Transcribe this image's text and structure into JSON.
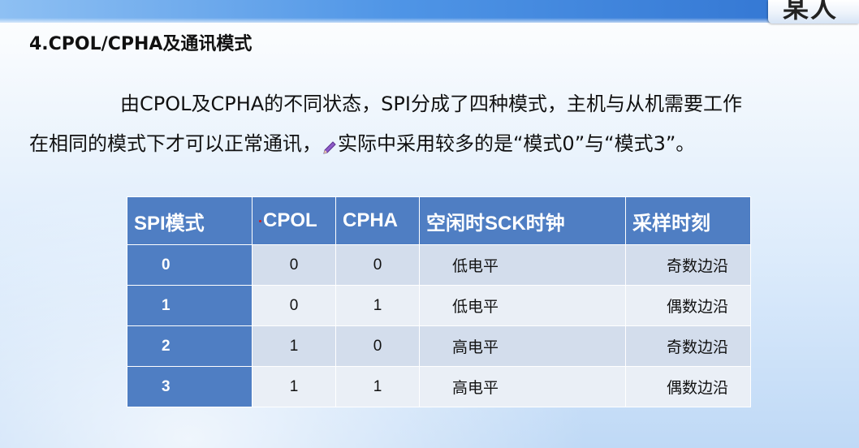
{
  "header": {
    "corner_tab_text": "某人"
  },
  "slide": {
    "title": "4.CPOL/CPHA及通讯模式",
    "paragraph": {
      "line1": "由CPOL及CPHA的不同状态，SPI分成了四种模式，主机与从机需要工作",
      "line2_before": "在相同的模式下才可以正常通讯，",
      "line2_after": "实际中采用较多的是“模式0”与“模式3”。",
      "inline_icon": "pen-icon"
    }
  },
  "table": {
    "headers": [
      "SPI模式",
      "CPOL",
      "CPHA",
      "空闲时SCK时钟",
      "采样时刻"
    ],
    "rows": [
      {
        "mode": "0",
        "cpol": "0",
        "cpha": "0",
        "sck_idle": "低电平",
        "sample": "奇数边沿"
      },
      {
        "mode": "1",
        "cpol": "0",
        "cpha": "1",
        "sck_idle": "低电平",
        "sample": "偶数边沿"
      },
      {
        "mode": "2",
        "cpol": "1",
        "cpha": "0",
        "sck_idle": "高电平",
        "sample": "奇数边沿"
      },
      {
        "mode": "3",
        "cpol": "1",
        "cpha": "1",
        "sck_idle": "高电平",
        "sample": "偶数边沿"
      }
    ]
  },
  "colors": {
    "header_blue": "#4f7ec3",
    "row_dark": "#d3ddec",
    "row_light": "#eaeff6",
    "band_blue": "#4f95e6"
  }
}
